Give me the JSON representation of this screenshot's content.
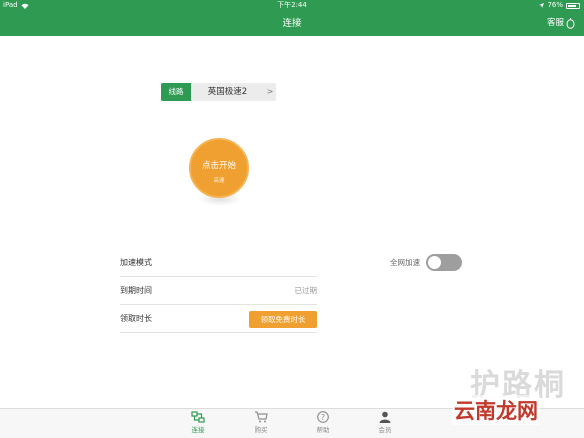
{
  "status_bar": {
    "device": "iPad",
    "time": "下午2:44",
    "battery": "76%",
    "battery_level": 0.76
  },
  "nav": {
    "title": "连接",
    "right_label": "客服"
  },
  "route": {
    "tag": "线路",
    "name": "英国极速2",
    "arrow": ">"
  },
  "start_button": {
    "label": "点击开始",
    "status": "高速"
  },
  "settings": {
    "mode_label": "加速模式",
    "mode_switch_label": "全网加速",
    "mode_switch_on": false,
    "expiry_label": "到期时间",
    "expiry_value": "已过期",
    "claim_label": "领取时长",
    "claim_button": "领取免费时长"
  },
  "tabs": [
    {
      "label": "连接",
      "icon": "connect-icon",
      "active": true
    },
    {
      "label": "购买",
      "icon": "cart-icon",
      "active": false
    },
    {
      "label": "帮助",
      "icon": "help-icon",
      "active": false
    },
    {
      "label": "会员",
      "icon": "member-icon",
      "active": false
    }
  ],
  "watermark": {
    "top": "护路桐",
    "bottom": "云南龙网"
  }
}
